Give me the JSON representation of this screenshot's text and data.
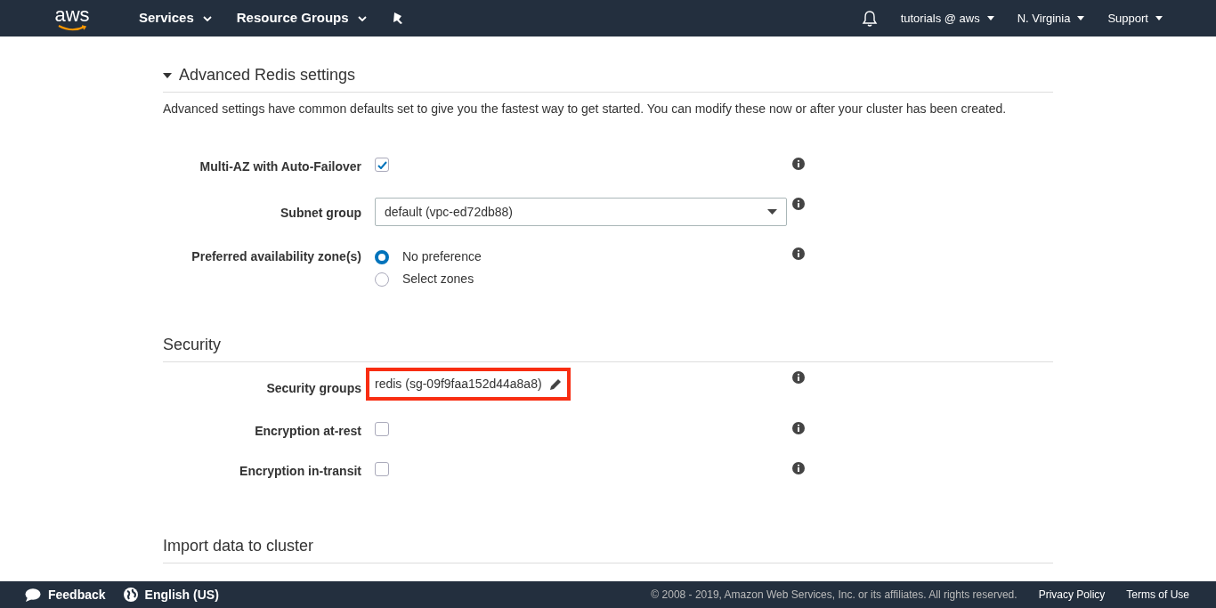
{
  "navbar": {
    "logo": "aws",
    "menus": [
      {
        "label": "Services"
      },
      {
        "label": "Resource Groups"
      }
    ],
    "right_menus": [
      {
        "label": "tutorials @ aws"
      },
      {
        "label": "N. Virginia"
      },
      {
        "label": "Support"
      }
    ]
  },
  "sections": [
    {
      "title": "Advanced Redis settings",
      "expanded": true,
      "description": "Advanced settings have common defaults set to give you the fastest way to get started. You can modify these now or after your cluster has been created.",
      "fields": [
        {
          "kind": "checkbox",
          "label": "Multi-AZ with Auto-Failover",
          "checked": true
        },
        {
          "kind": "select",
          "label": "Subnet group",
          "value": "default (vpc-ed72db88)"
        },
        {
          "kind": "radio",
          "label": "Preferred availability zone(s)",
          "options": [
            {
              "label": "No preference",
              "selected": true
            },
            {
              "label": "Select zones",
              "selected": false
            }
          ]
        }
      ]
    },
    {
      "title": "Security",
      "fields": [
        {
          "kind": "value",
          "label": "Security groups",
          "value": "redis (sg-09f9faa152d44a8a8)",
          "highlighted": true
        },
        {
          "kind": "checkbox",
          "label": "Encryption at-rest",
          "checked": false
        },
        {
          "kind": "checkbox",
          "label": "Encryption in-transit",
          "checked": false
        }
      ]
    },
    {
      "title": "Import data to cluster"
    }
  ],
  "footer": {
    "feedback": "Feedback",
    "language": "English (US)",
    "copyright": "© 2008 - 2019, Amazon Web Services, Inc. or its affiliates. All rights reserved.",
    "links": [
      "Privacy Policy",
      "Terms of Use"
    ]
  }
}
